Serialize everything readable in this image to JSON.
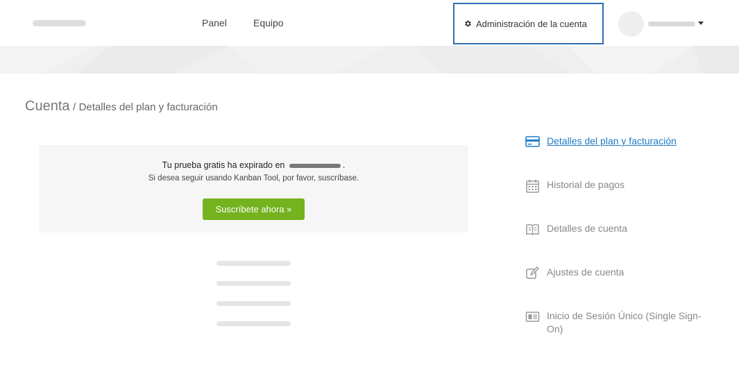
{
  "nav": {
    "links": [
      "Panel",
      "Equipo"
    ],
    "account_admin": "Administración de la cuenta"
  },
  "breadcrumb": {
    "main": "Cuenta",
    "separator": "/",
    "sub": "Detalles del plan y facturación"
  },
  "trial": {
    "title_prefix": "Tu prueba gratis ha expirado en",
    "title_suffix": ".",
    "subtitle": "Si desea seguir usando Kanban Tool, por favor, suscríbase.",
    "button": "Suscríbete ahora »"
  },
  "sidebar": {
    "items": [
      {
        "label": "Detalles del plan y facturación",
        "icon": "credit-card-icon",
        "active": true
      },
      {
        "label": "Historial de pagos",
        "icon": "calendar-icon",
        "active": false
      },
      {
        "label": "Detalles de cuenta",
        "icon": "book-icon",
        "active": false
      },
      {
        "label": "Ajustes de cuenta",
        "icon": "edit-icon",
        "active": false
      },
      {
        "label": "Inicio de Sesión Único (Single Sign-On)",
        "icon": "id-card-icon",
        "active": false
      }
    ]
  },
  "colors": {
    "accent": "#1f7bc4",
    "button": "#74b21e",
    "highlight_border": "#2e6fb5"
  }
}
